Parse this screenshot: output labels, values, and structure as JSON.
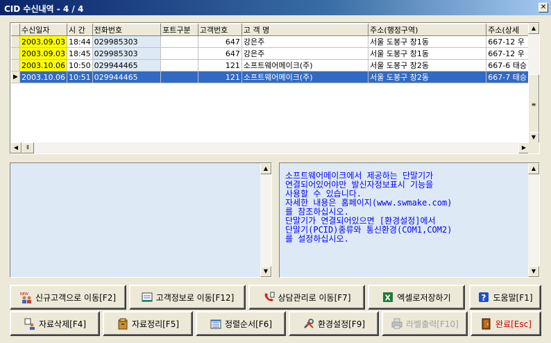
{
  "window": {
    "title": "CID 수신내역 - 4 / 4",
    "close": "✕"
  },
  "grid": {
    "columns": [
      "수신일자",
      "시 간",
      "전화번호",
      "포트구분",
      "고객번호",
      "고 객 명",
      "주소(행정구역)",
      "주소(상세"
    ],
    "rows": [
      [
        "2003.09.03",
        "18:44",
        "029985303",
        "",
        "647",
        "강은주",
        "서울 도봉구 창1동",
        "667-12 우"
      ],
      [
        "2003.09.03",
        "18:45",
        "029985303",
        "",
        "647",
        "강은주",
        "서울 도봉구 창1동",
        "667-12 우"
      ],
      [
        "2003.10.06",
        "10:50",
        "029944465",
        "",
        "121",
        "소프트웨어메이크(주)",
        "서울 도봉구 창2동",
        "667-6 태승"
      ],
      [
        "2003.10.06",
        "10:51",
        "029944465",
        "",
        "121",
        "소프트웨어메이크(주)",
        "서울 도봉구 창2동",
        "667-7 태승"
      ]
    ],
    "selected_row": 3
  },
  "memo_right": {
    "lines": [
      "소프트웨어메이크에서 제공하는 단말기가",
      "연결되어있어야만 발신자정보표시 기능을",
      "사용할 수 있습니다.",
      "",
      "자세한 내용은 홈페이지(www.swmake.com)",
      "를 참조하십시오.",
      "",
      "단말기가 연결되어있으면 [환경설정]에서",
      "단말기(PCID)종류와 통신환경(COM1,COM2)",
      "를 설정하십시오."
    ]
  },
  "buttons": {
    "new_customer": "신규고객으로 이동[F2]",
    "customer_info": "고객정보로 이동[F12]",
    "consult": "상담관리로 이동[F7]",
    "excel": "엑셀로저장하기",
    "help": "도움말[F1]",
    "delete": "자료삭제[F4]",
    "cleanup": "자료정리[F5]",
    "sort": "정렬순서[F6]",
    "settings": "환경설정[F9]",
    "label_print": "라벨출력[F10]",
    "done": "완료[Esc]"
  },
  "icons": {
    "new_customer": "new-person-icon",
    "customer_info": "id-card-icon",
    "consult": "phone-icon",
    "excel": "excel-icon",
    "help": "help-icon",
    "delete": "delete-person-icon",
    "cleanup": "archive-icon",
    "sort": "sort-icon",
    "settings": "tools-icon",
    "label_print": "printer-icon",
    "done": "exit-door-icon"
  }
}
